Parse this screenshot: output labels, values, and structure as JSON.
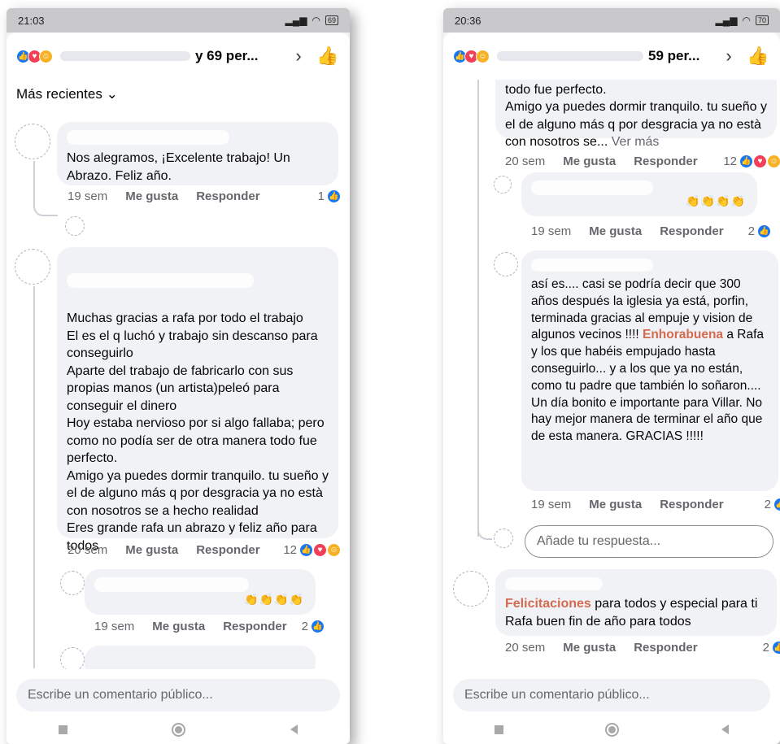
{
  "left": {
    "status": {
      "time": "21:03",
      "battery": "69"
    },
    "header": {
      "title_suffix": "y 69 per..."
    },
    "sort_label": "Más recientes",
    "comments": [
      {
        "text": "Nos alegramos, ¡Excelente trabajo! Un Abrazo. Feliz año.",
        "time": "19 sem",
        "like": "Me gusta",
        "reply": "Responder",
        "count": "1"
      },
      {
        "text": "Muchas gracias a rafa por todo el trabajo\nEl es el q luchó y trabajo sin descanso para conseguirlo\nAparte del trabajo de fabricarlo con sus propias manos (un artista)peleó para conseguir el dinero\nHoy estaba nervioso por si algo fallaba; pero como no podía ser de otra manera todo fue perfecto.\nAmigo ya puedes dormir tranquilo. tu sueño y el de alguno más q por desgracia ya no està con nosotros se a hecho realidad\nEres grande rafa un abrazo y feliz año para todos",
        "time": "20 sem",
        "like": "Me gusta",
        "reply": "Responder",
        "count": "12"
      },
      {
        "time": "19 sem",
        "like": "Me gusta",
        "reply": "Responder",
        "count": "2"
      }
    ],
    "composer_placeholder": "Escribe un comentario público..."
  },
  "right": {
    "status": {
      "time": "20:36",
      "battery": "70"
    },
    "header": {
      "title_suffix": "59 per..."
    },
    "top_text": "todo fue perfecto.\nAmigo ya puedes dormir tranquilo. tu sueño y el de alguno más q por desgracia ya no està con nosotros se... ",
    "see_more": "Ver más",
    "top_meta": {
      "time": "20 sem",
      "like": "Me gusta",
      "reply": "Responder",
      "count": "12"
    },
    "reply1_meta": {
      "time": "19 sem",
      "like": "Me gusta",
      "reply": "Responder",
      "count": "2"
    },
    "reply2": {
      "text_a": "así es.... casi se podría decir que 300 años después la iglesia ya está, porfin, terminada gracias al empuje y vision de algunos vecinos !!!! ",
      "highlight": "Enhorabuena",
      "text_b": " a Rafa y los que habéis empujado hasta conseguirlo... y a los que ya no están, como tu padre        que también lo soñaron.... Un día bonito e importante para Villar. No hay mejor manera de terminar el año que de esta manera. GRACIAS !!!!!",
      "time": "19 sem",
      "like": "Me gusta",
      "reply": "Responder",
      "count": "2"
    },
    "reply_placeholder": "Añade tu respuesta...",
    "comment3": {
      "highlight": "Felicitaciones",
      "text": " para todos y especial para ti Rafa buen fin de año  para todos",
      "time": "20 sem",
      "like": "Me gusta",
      "reply": "Responder",
      "count": "2"
    },
    "composer_placeholder": "Escribe un comentario público..."
  },
  "icons": {
    "like": "thumbs-up-icon",
    "love": "heart-icon",
    "care": "care-icon"
  },
  "colors": {
    "accent": "#1877f2",
    "love": "#f33e58",
    "care": "#f7b125",
    "highlight": "#d46a50"
  }
}
